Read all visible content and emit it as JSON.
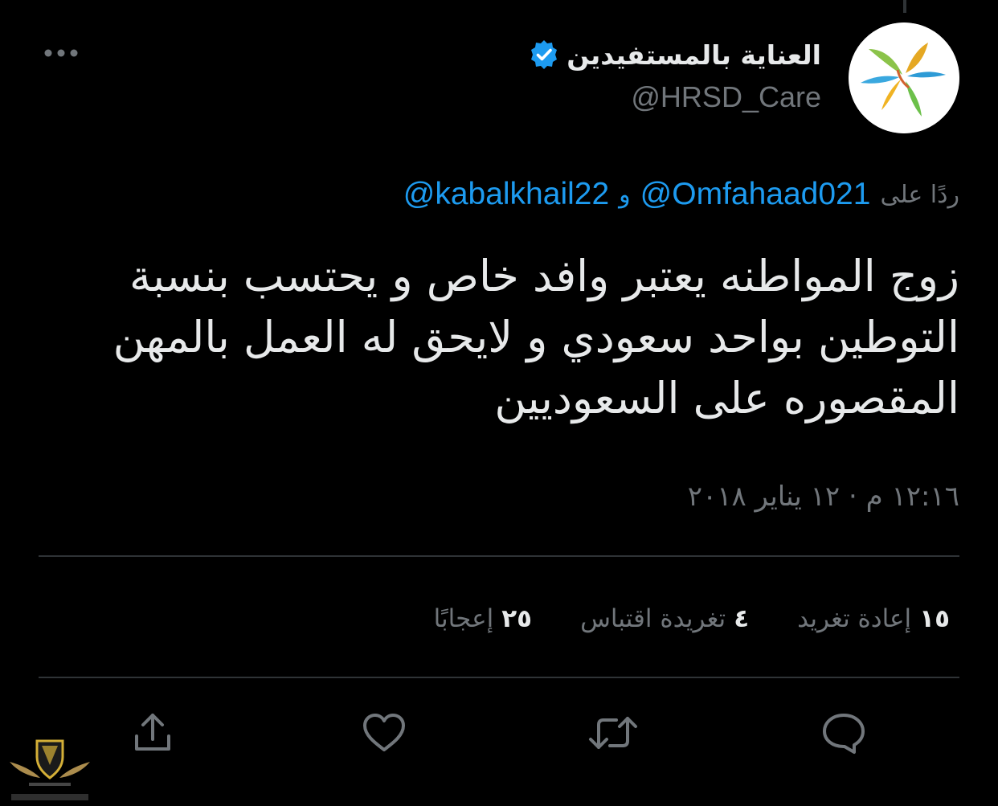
{
  "tweet": {
    "author": {
      "display_name": "العناية بالمستفيدين",
      "handle": "@HRSD_Care",
      "verified": true,
      "avatar_icon": "hrsd-logo"
    },
    "reply_to": {
      "label": "ردًا على",
      "mentions": [
        "@Omfahaad021",
        "@kabalkhail22"
      ],
      "conjunction": "و"
    },
    "text_lines": [
      "زوج المواطنه يعتبر وافد خاص و يحتسب بنسبة",
      "التوطين بواحد سعودي و لايحق له العمل بالمهن",
      "المقصوره على السعوديين"
    ],
    "timestamp": "١٢:١٦ م · ١٢ يناير ٢٠١٨",
    "stats": [
      {
        "count": "١٥",
        "label": "إعادة تغريد"
      },
      {
        "count": "٤",
        "label": "تغريدة اقتباس"
      },
      {
        "count": "٢٥",
        "label": "إعجابًا"
      }
    ],
    "actions": [
      "reply-icon",
      "retweet-icon",
      "like-icon",
      "share-icon"
    ]
  },
  "colors": {
    "background": "#000000",
    "text_primary": "#e7e9ea",
    "text_secondary": "#71767b",
    "link": "#1d9bf0",
    "divider": "#2f3336",
    "verified_badge": "#1d9bf0"
  }
}
